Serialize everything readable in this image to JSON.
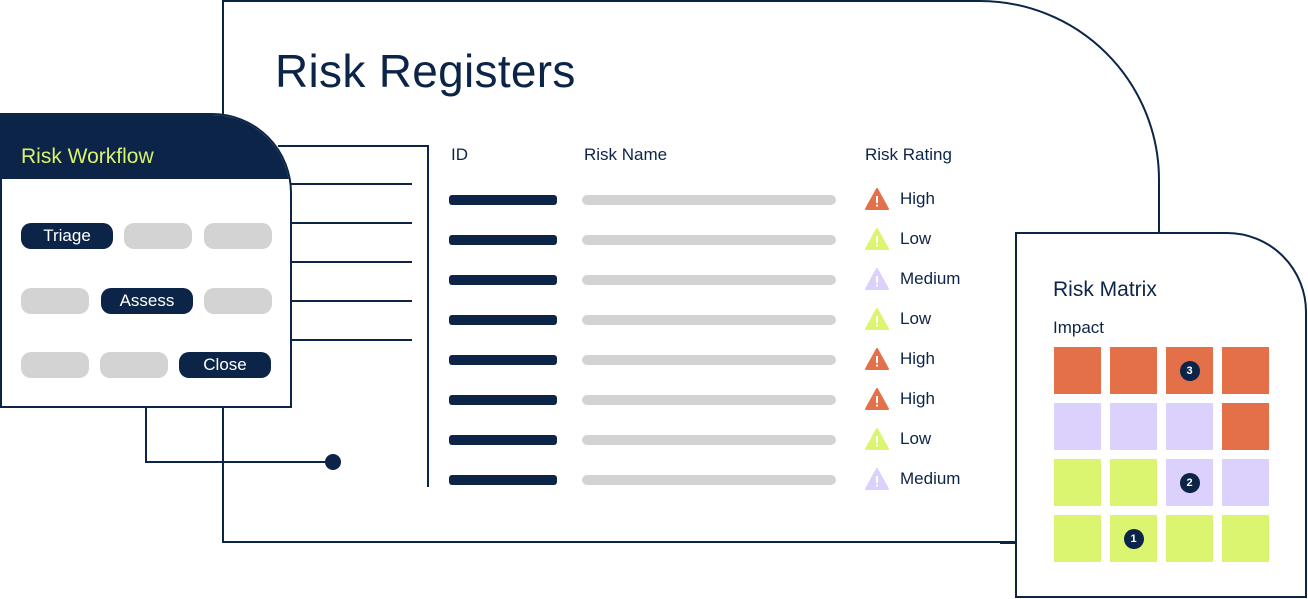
{
  "register": {
    "title": "Risk Registers",
    "columns": {
      "id": "ID",
      "name": "Risk Name",
      "rating": "Risk Rating"
    },
    "rows": [
      {
        "rating": "High"
      },
      {
        "rating": "Low"
      },
      {
        "rating": "Medium"
      },
      {
        "rating": "Low"
      },
      {
        "rating": "High"
      },
      {
        "rating": "High"
      },
      {
        "rating": "Low"
      },
      {
        "rating": "Medium"
      }
    ]
  },
  "rating_colors": {
    "High": "#e4704a",
    "Medium": "#dcd0fc",
    "Low": "#dbf570"
  },
  "rating_icon": "warning-triangle-icon",
  "workflow": {
    "title": "Risk Workflow",
    "steps": [
      {
        "label": "Triage",
        "active": true
      },
      {
        "label": "",
        "active": false
      },
      {
        "label": "",
        "active": false
      },
      {
        "label": "",
        "active": false
      },
      {
        "label": "Assess",
        "active": true
      },
      {
        "label": "",
        "active": false
      },
      {
        "label": "",
        "active": false
      },
      {
        "label": "",
        "active": false
      },
      {
        "label": "Close",
        "active": true
      }
    ]
  },
  "matrix": {
    "title": "Risk Matrix",
    "axis_label": "Impact",
    "grid": [
      [
        "High",
        "High",
        "High",
        "High"
      ],
      [
        "Medium",
        "Medium",
        "Medium",
        "High"
      ],
      [
        "Low",
        "Low",
        "Medium",
        "Medium"
      ],
      [
        "Low",
        "Low",
        "Low",
        "Low"
      ]
    ],
    "markers": [
      {
        "label": "3",
        "row": 0,
        "col": 2
      },
      {
        "label": "2",
        "row": 2,
        "col": 2
      },
      {
        "label": "1",
        "row": 3,
        "col": 1
      }
    ]
  },
  "colors": {
    "navy": "#0c2448",
    "accent_lime": "#d9f26b",
    "placeholder_gray": "#d3d3d3"
  }
}
